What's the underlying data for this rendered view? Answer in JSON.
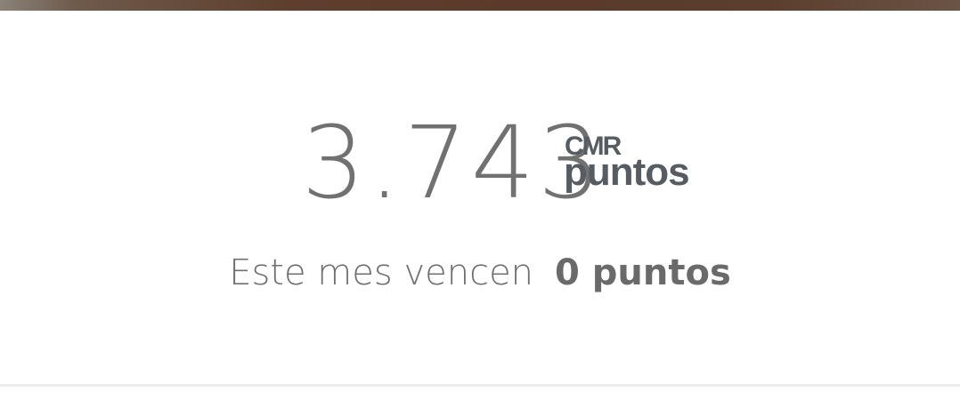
{
  "points": {
    "value": "3.743",
    "brand_line1": "CMR",
    "brand_line2": "puntos"
  },
  "expiry": {
    "text": "Este mes vencen",
    "amount": "0 puntos"
  },
  "colors": {
    "top_strip": "#5a3a2a",
    "text_gray": "#717171",
    "brand_gray": "#555c62",
    "background": "#ffffff"
  }
}
